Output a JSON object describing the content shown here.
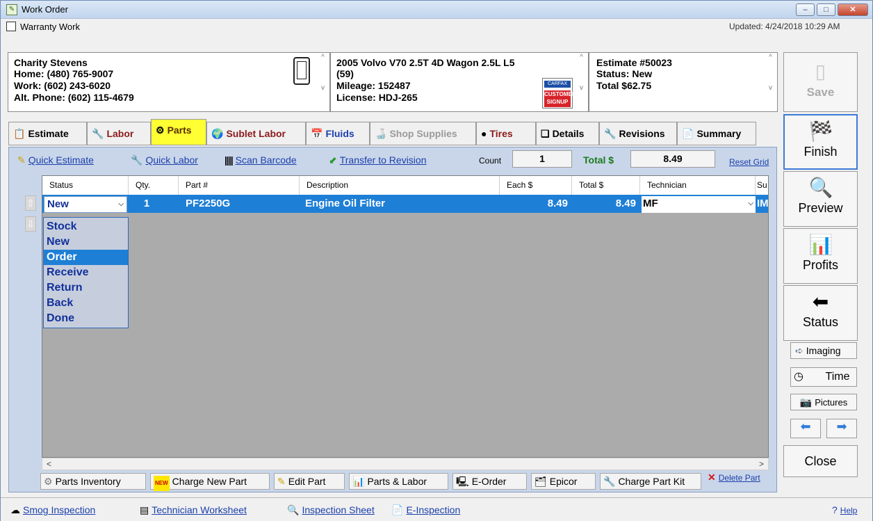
{
  "window": {
    "title": "Work Order",
    "min": "–",
    "max": "□",
    "close": "✕"
  },
  "header": {
    "warranty_label": "Warranty Work",
    "updated": "Updated: 4/24/2018 10:29 AM"
  },
  "customer": {
    "name": "Charity Stevens",
    "home": "Home: (480) 765-9007",
    "work": "Work: (602) 243-6020",
    "alt": "Alt. Phone: (602) 115-4679"
  },
  "vehicle": {
    "line1": "2005 Volvo V70 2.5T 4D Wagon 2.5L L5",
    "line2": "(59)",
    "mileage": "Mileage: 152487",
    "license": "License: HDJ-265",
    "badge_top": "CARFAX",
    "badge_bottom": "CUSTOMER SIGNUP"
  },
  "estimate": {
    "number": "Estimate #50023",
    "status": "Status: New",
    "total": "Total $62.75"
  },
  "tabs": [
    {
      "label": "Estimate",
      "icon": "📋"
    },
    {
      "label": "Labor",
      "icon": "🔧"
    },
    {
      "label": "Parts",
      "icon": "⚙"
    },
    {
      "label": "Sublet Labor",
      "icon": "🌍"
    },
    {
      "label": "Fluids",
      "icon": "📅"
    },
    {
      "label": "Shop Supplies",
      "icon": "🍶"
    },
    {
      "label": "Tires",
      "icon": "●"
    },
    {
      "label": "Details",
      "icon": "❑"
    },
    {
      "label": "Revisions",
      "icon": "🔧"
    },
    {
      "label": "Summary",
      "icon": "📄"
    }
  ],
  "toolbar": {
    "quick_estimate": "Quick Estimate",
    "quick_labor": "Quick Labor",
    "scan_barcode": "Scan Barcode",
    "transfer": "Transfer to Revision",
    "count_label": "Count",
    "count_value": "1",
    "total_label": "Total $",
    "total_value": "8.49",
    "reset_grid": "Reset Grid"
  },
  "grid": {
    "columns": [
      "Status",
      "Qty.",
      "Part #",
      "Description",
      "Each $",
      "Total $",
      "Technician",
      "Su"
    ],
    "row": {
      "status": "New",
      "qty": "1",
      "part": "PF2250G",
      "description": "Engine Oil Filter",
      "each": "8.49",
      "total": "8.49",
      "tech": "MF",
      "su": "IM"
    },
    "status_options": [
      "Stock",
      "New",
      "Order",
      "Receive",
      "Return",
      "Back",
      "Done"
    ],
    "selected_option": "Order"
  },
  "bottom_buttons": {
    "parts_inventory": "Parts Inventory",
    "charge_new_part": "Charge New Part",
    "new_badge": "NEW",
    "edit_part": "Edit Part",
    "parts_labor": "Parts & Labor",
    "e_order": "E-Order",
    "epicor": "Epicor",
    "charge_part_kit": "Charge Part Kit",
    "delete_part": "Delete Part"
  },
  "sidebar": {
    "save": "Save",
    "finish": "Finish",
    "preview": "Preview",
    "profits": "Profits",
    "status": "Status",
    "imaging": "Imaging",
    "time": "Time",
    "pictures": "Pictures",
    "close": "Close"
  },
  "statusbar": {
    "smog": "Smog Inspection",
    "worksheet": "Technician Worksheet",
    "inspection": "Inspection Sheet",
    "e_inspection": "E-Inspection",
    "help": "Help"
  }
}
